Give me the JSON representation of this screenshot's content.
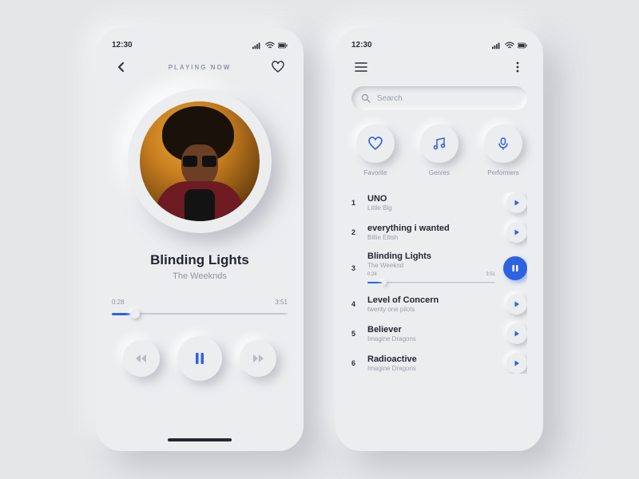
{
  "status": {
    "time": "12:30"
  },
  "player": {
    "header_label": "PLAYING NOW",
    "title": "Blinding Lights",
    "artist": "The Weeknds",
    "elapsed": "0:28",
    "total": "3:51",
    "progress_pct": 13
  },
  "library": {
    "search_placeholder": "Search",
    "categories": [
      {
        "label": "Favorite"
      },
      {
        "label": "Genres"
      },
      {
        "label": "Performers"
      }
    ],
    "tracks": [
      {
        "n": "1",
        "title": "UNO",
        "artist": "Little Big",
        "playing": false
      },
      {
        "n": "2",
        "title": "everything i wanted",
        "artist": "Billie Eilish",
        "playing": false
      },
      {
        "n": "3",
        "title": "Blinding Lights",
        "artist": "The Weeknd",
        "playing": true,
        "elapsed": "0:28",
        "total": "3:51",
        "progress_pct": 13
      },
      {
        "n": "4",
        "title": "Level of Concern",
        "artist": "twenty one pilots",
        "playing": false
      },
      {
        "n": "5",
        "title": "Believer",
        "artist": "Imagine Dragons",
        "playing": false
      },
      {
        "n": "6",
        "title": "Radioactive",
        "artist": "Imagine Dragons",
        "playing": false
      }
    ]
  }
}
